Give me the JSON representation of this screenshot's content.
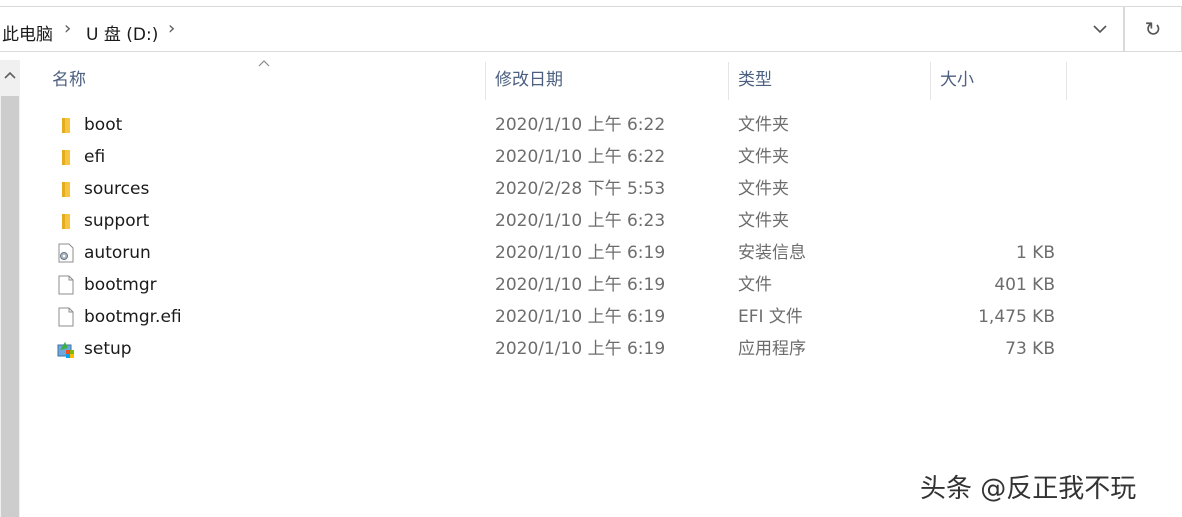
{
  "address": {
    "crumbs": [
      "此电脑",
      "U 盘 (D:)"
    ]
  },
  "columns": {
    "name": "名称",
    "date": "修改日期",
    "type": "类型",
    "size": "大小"
  },
  "files": [
    {
      "name": "boot",
      "date": "2020/1/10 上午 6:22",
      "type": "文件夹",
      "size": "",
      "icon": "folder-icon"
    },
    {
      "name": "efi",
      "date": "2020/1/10 上午 6:22",
      "type": "文件夹",
      "size": "",
      "icon": "folder-icon"
    },
    {
      "name": "sources",
      "date": "2020/2/28 下午 5:53",
      "type": "文件夹",
      "size": "",
      "icon": "folder-icon"
    },
    {
      "name": "support",
      "date": "2020/1/10 上午 6:23",
      "type": "文件夹",
      "size": "",
      "icon": "folder-icon"
    },
    {
      "name": "autorun",
      "date": "2020/1/10 上午 6:19",
      "type": "安装信息",
      "size": "1 KB",
      "icon": "setup-info-icon"
    },
    {
      "name": "bootmgr",
      "date": "2020/1/10 上午 6:19",
      "type": "文件",
      "size": "401 KB",
      "icon": "file-icon"
    },
    {
      "name": "bootmgr.efi",
      "date": "2020/1/10 上午 6:19",
      "type": "EFI 文件",
      "size": "1,475 KB",
      "icon": "file-icon"
    },
    {
      "name": "setup",
      "date": "2020/1/10 上午 6:19",
      "type": "应用程序",
      "size": "73 KB",
      "icon": "setup-app-icon"
    }
  ],
  "watermark": "头条 @反正我不玩",
  "colors": {
    "folder": "#f5c542",
    "header_text": "#4d6082",
    "secondary_text": "#6d6d6d"
  }
}
